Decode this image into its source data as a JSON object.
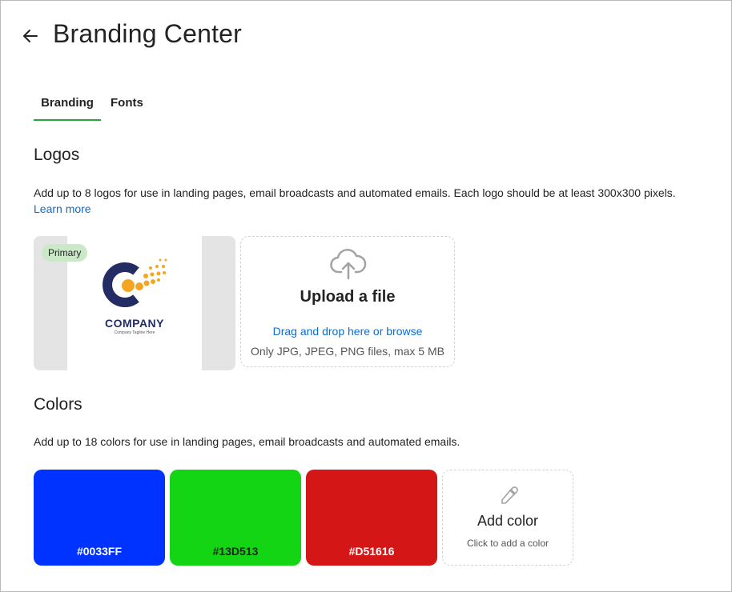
{
  "header": {
    "title": "Branding Center",
    "back_icon": "arrow-left-icon"
  },
  "tabs": [
    {
      "label": "Branding",
      "active": true
    },
    {
      "label": "Fonts",
      "active": false
    }
  ],
  "logos": {
    "title": "Logos",
    "description": "Add up to 8 logos for use in landing pages, email broadcasts and automated emails. Each logo should be at least 300x300 pixels.",
    "learn_more": "Learn more",
    "items": [
      {
        "badge": "Primary",
        "company_text": "COMPANY",
        "tagline": "Company Tagline Here"
      }
    ],
    "upload": {
      "icon": "cloud-upload-icon",
      "title": "Upload a file",
      "link": "Drag and drop here or browse",
      "hint": "Only JPG, JPEG, PNG files, max 5 MB"
    }
  },
  "colors": {
    "title": "Colors",
    "description": "Add up to 18 colors for use in landing pages, email broadcasts and automated emails.",
    "swatches": [
      {
        "hex": "#0033FF",
        "label": "#0033FF"
      },
      {
        "hex": "#13D513",
        "label": "#13D513"
      },
      {
        "hex": "#D51616",
        "label": "#D51616"
      }
    ],
    "add": {
      "icon": "eyedropper-icon",
      "title": "Add color",
      "hint": "Click to add a color"
    }
  },
  "theme": {
    "accent_green": "#2aa63a",
    "link_blue": "#0b6cd1",
    "badge_green": "#cbe9c8"
  }
}
